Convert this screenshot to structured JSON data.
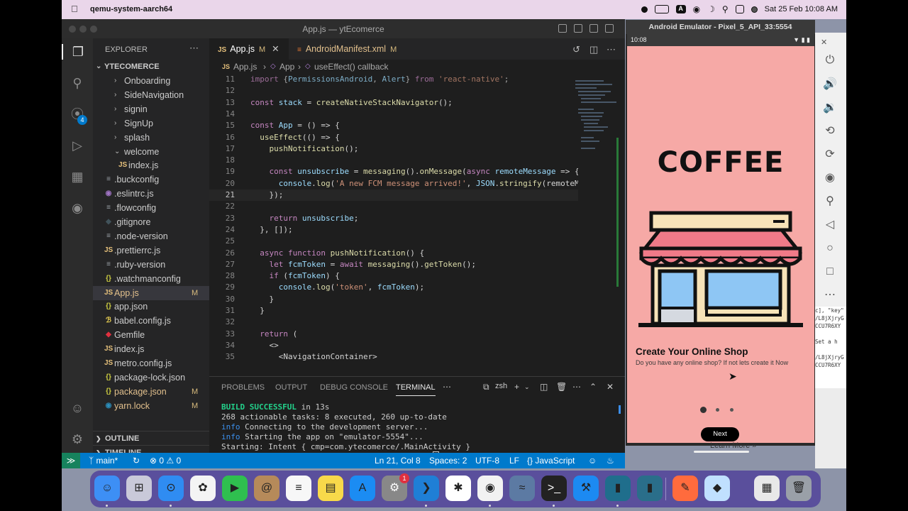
{
  "menubar": {
    "app": "qemu-system-aarch64",
    "datetime": "Sat 25 Feb 10:08 AM"
  },
  "vscode": {
    "title": "App.js — ytEcomerce",
    "explorer_label": "EXPLORER",
    "project": "YTECOMERCE",
    "tree": [
      {
        "label": "Onboarding",
        "type": "folder",
        "indent": 1
      },
      {
        "label": "SideNavigation",
        "type": "folder",
        "indent": 1
      },
      {
        "label": "signin",
        "type": "folder",
        "indent": 1
      },
      {
        "label": "SignUp",
        "type": "folder",
        "indent": 1
      },
      {
        "label": "splash",
        "type": "folder",
        "indent": 1
      },
      {
        "label": "welcome",
        "type": "folder-open",
        "indent": 1
      },
      {
        "label": "index.js",
        "type": "js",
        "indent": 2
      },
      {
        "label": ".buckconfig",
        "type": "lines",
        "indent": 0
      },
      {
        "label": ".eslintrc.js",
        "type": "eslint",
        "indent": 0
      },
      {
        "label": ".flowconfig",
        "type": "lines",
        "indent": 0
      },
      {
        "label": ".gitignore",
        "type": "git",
        "indent": 0
      },
      {
        "label": ".node-version",
        "type": "lines",
        "indent": 0
      },
      {
        "label": ".prettierrc.js",
        "type": "js",
        "indent": 0
      },
      {
        "label": ".ruby-version",
        "type": "lines",
        "indent": 0
      },
      {
        "label": ".watchmanconfig",
        "type": "json",
        "indent": 0
      },
      {
        "label": "App.js",
        "type": "js",
        "indent": 0,
        "mark": "M",
        "selected": true
      },
      {
        "label": "app.json",
        "type": "json",
        "indent": 0
      },
      {
        "label": "babel.config.js",
        "type": "babel",
        "indent": 0
      },
      {
        "label": "Gemfile",
        "type": "ruby",
        "indent": 0
      },
      {
        "label": "index.js",
        "type": "js",
        "indent": 0
      },
      {
        "label": "metro.config.js",
        "type": "js",
        "indent": 0
      },
      {
        "label": "package-lock.json",
        "type": "json",
        "indent": 0
      },
      {
        "label": "package.json",
        "type": "json",
        "indent": 0,
        "mark": "M"
      },
      {
        "label": "yarn.lock",
        "type": "yarn",
        "indent": 0,
        "mark": "M"
      }
    ],
    "outline_label": "OUTLINE",
    "timeline_label": "TIMELINE",
    "tabs": [
      {
        "label": "App.js",
        "mark": "M",
        "active": true
      },
      {
        "label": "AndroidManifest.xml",
        "mark": "M",
        "active": false
      }
    ],
    "breadcrumb": [
      "App.js",
      "App",
      "useEffect() callback"
    ],
    "code": [
      {
        "n": "11",
        "t": "import {PermissionsAndroid, Alert} from 'react-native';"
      },
      {
        "n": "12",
        "t": ""
      },
      {
        "n": "13",
        "t": "const stack = createNativeStackNavigator();"
      },
      {
        "n": "14",
        "t": ""
      },
      {
        "n": "15",
        "t": "const App = () => {"
      },
      {
        "n": "16",
        "t": "  useEffect(() => {"
      },
      {
        "n": "17",
        "t": "    pushNotification();"
      },
      {
        "n": "18",
        "t": ""
      },
      {
        "n": "19",
        "t": "    const unsubscribe = messaging().onMessage(async remoteMessage => {"
      },
      {
        "n": "20",
        "t": "      console.log('A new FCM message arrived!', JSON.stringify(remoteM"
      },
      {
        "n": "21",
        "t": "    });"
      },
      {
        "n": "22",
        "t": ""
      },
      {
        "n": "23",
        "t": "    return unsubscribe;"
      },
      {
        "n": "24",
        "t": "  }, []);"
      },
      {
        "n": "25",
        "t": ""
      },
      {
        "n": "26",
        "t": "  async function pushNotification() {"
      },
      {
        "n": "27",
        "t": "    let fcmToken = await messaging().getToken();"
      },
      {
        "n": "28",
        "t": "    if (fcmToken) {"
      },
      {
        "n": "29",
        "t": "      console.log('token', fcmToken);"
      },
      {
        "n": "30",
        "t": "    }"
      },
      {
        "n": "31",
        "t": "  }"
      },
      {
        "n": "32",
        "t": ""
      },
      {
        "n": "33",
        "t": "  return ("
      },
      {
        "n": "34",
        "t": "    <>"
      },
      {
        "n": "35",
        "t": "      <NavigationContainer>"
      }
    ],
    "panel_tabs": [
      "PROBLEMS",
      "OUTPUT",
      "DEBUG CONSOLE",
      "TERMINAL"
    ],
    "active_panel": "TERMINAL",
    "shell": "zsh",
    "terminal": [
      {
        "t": "BUILD SUCCESSFUL",
        "rest": " in 13s",
        "style": "g"
      },
      {
        "t": "268 actionable tasks: 8 executed, 260 up-to-date",
        "rest": "",
        "style": ""
      },
      {
        "t": "info",
        "rest": " Connecting to the development server...",
        "style": "b"
      },
      {
        "t": "info",
        "rest": " Starting the app on \"emulator-5554\"...",
        "style": "b"
      },
      {
        "t": "Starting: Intent { cmp=com.ytecomerce/.MainActivity }",
        "rest": "",
        "style": ""
      },
      {
        "t": "zainulabideen@Zains-MacBook-Air ytEcomerce % ",
        "rest": "",
        "style": ""
      }
    ],
    "status": {
      "branch": "main*",
      "problems": "0",
      "warnings": "0",
      "position": "Ln 21, Col 8",
      "spaces": "Spaces: 2",
      "encoding": "UTF-8",
      "eol": "LF",
      "language": "JavaScript"
    }
  },
  "emulator": {
    "title": "Android Emulator - Pixel_5_API_33:5554",
    "clock": "10:08",
    "coffee": "COFFEE",
    "onboarding_title": "Create Your Online Shop",
    "onboarding_subtitle": "Do you have any online shop? If not lets create it Now",
    "page_index": 1,
    "page_count": 3,
    "next_label": "Next",
    "shop_colors": {
      "awning": "#f07a88",
      "frame": "#f7e3b8",
      "glass": "#8ec6f4",
      "outline": "#111111"
    }
  },
  "background": {
    "link": "Learn More »",
    "terminal_snippet": [
      "c], \"key\"",
      "/L8jXjryG",
      "CCU7R6XY",
      "",
      "Set a h",
      "",
      "/L8jXjryG",
      "CCU7R6XY"
    ]
  },
  "dock": {
    "apps": [
      "Finder",
      "Launchpad",
      "Safari",
      "Photos",
      "FaceTime",
      "Contacts",
      "Reminders",
      "Notes",
      "App Store",
      "System Preferences",
      "Visual Studio Code",
      "Slack",
      "Chrome",
      "Docker",
      "Terminal",
      "Xcode",
      "Simulator",
      "Simulator",
      "Pages",
      "Android Studio",
      "Downloads",
      "Trash"
    ],
    "badge": "1"
  }
}
